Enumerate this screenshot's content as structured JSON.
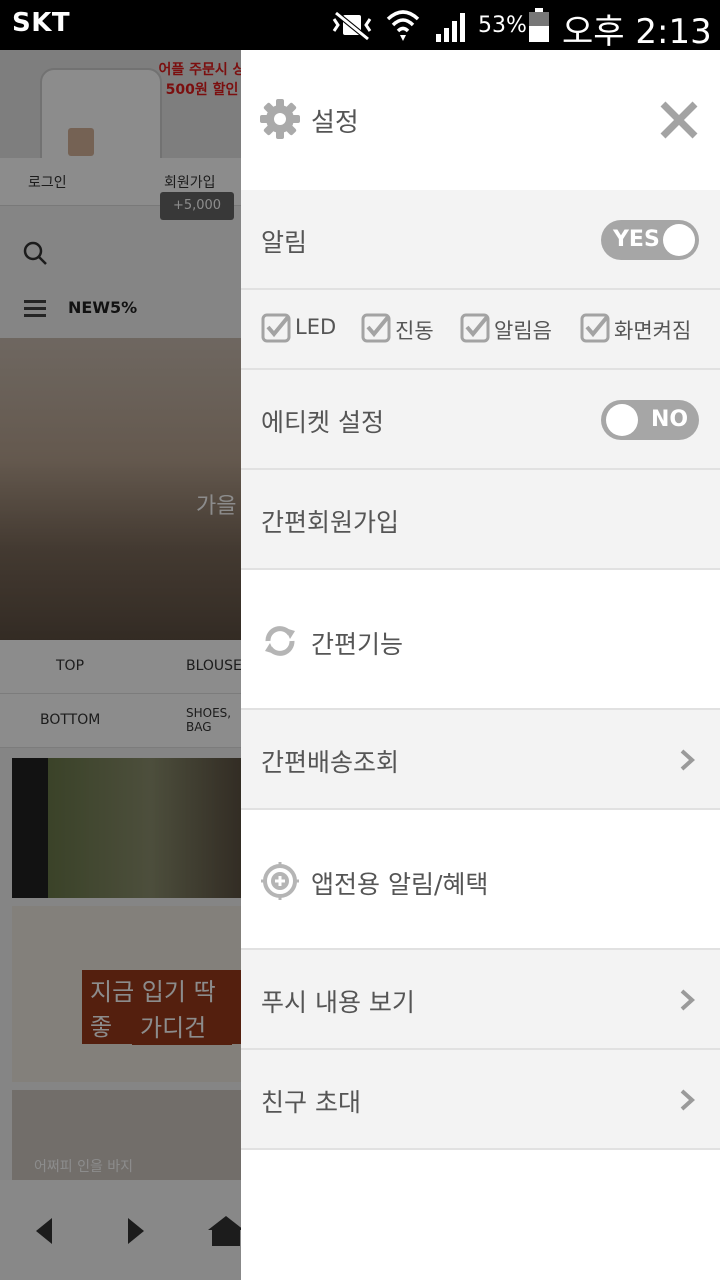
{
  "status_bar": {
    "carrier": "SKT",
    "battery_percent": "53%",
    "time": "오후 2:13"
  },
  "background_app": {
    "promo_line1": "어플 주문시 상",
    "promo_line2": "500원 할인",
    "login": "로그인",
    "signup": "회원가입",
    "bonus": "+5,000",
    "menu_label": "NEW5%",
    "banner_text": "가을",
    "categories_row1": [
      "TOP",
      "BLOUSE"
    ],
    "categories_row2": [
      "BOTTOM",
      "SHOES, BAG"
    ],
    "promo_card_line1": "지금 입기 딱 좋",
    "promo_card_line2": "가디건",
    "bottom_caption": "어쩌피 인을 바지"
  },
  "drawer": {
    "title": "설정",
    "notification": {
      "label": "알림",
      "toggle_text": "YES",
      "enabled": true
    },
    "options": [
      "LED",
      "진동",
      "알림음",
      "화면켜짐"
    ],
    "etiquette": {
      "label": "에티켓 설정",
      "toggle_text": "NO",
      "enabled": false
    },
    "easy_signup": "간편회원가입",
    "easy_features": "간편기능",
    "delivery_lookup": "간편배송조회",
    "app_benefits": "앱전용 알림/혜택",
    "push_content": "푸시 내용 보기",
    "invite_friends": "친구 초대"
  },
  "colors": {
    "toggle": "#a6a6a6",
    "icon": "#b5b5b5",
    "text": "#555555",
    "row_gray": "#f3f3f3",
    "divider": "#e1e1e1"
  }
}
